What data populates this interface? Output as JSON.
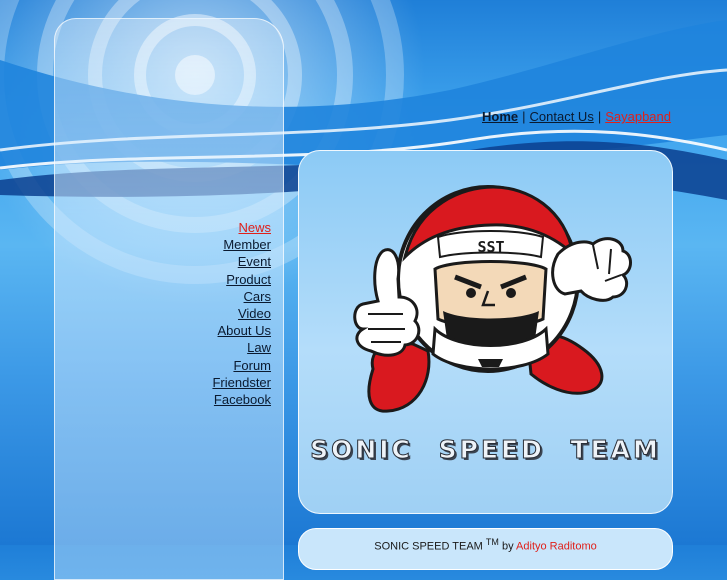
{
  "top_nav": {
    "home": "Home",
    "separator": "|",
    "contact": "Contact Us",
    "sayapband": "Sayapband"
  },
  "sidebar": {
    "items": [
      {
        "label": "News",
        "active": true
      },
      {
        "label": "Member"
      },
      {
        "label": "Event"
      },
      {
        "label": "Product"
      },
      {
        "label": "Cars"
      },
      {
        "label": "Video"
      },
      {
        "label": "About Us"
      },
      {
        "label": "Law"
      },
      {
        "label": "Forum"
      },
      {
        "label": "Friendster"
      },
      {
        "label": "Facebook"
      }
    ],
    "extra_link": " "
  },
  "mascot": {
    "helmet_text": "SST",
    "icon": "racing-mascot-thumbs-up"
  },
  "brand": {
    "title": "SONIC SPEED TEAM"
  },
  "footer": {
    "text": "SONIC SPEED TEAM",
    "trademark": "TM",
    "by": "by",
    "author": "Adityo Raditomo"
  },
  "colors": {
    "link": "#0a1a30",
    "active_link": "#e0201a",
    "panel": "#b4ddfa",
    "background": "#3fa4ee"
  }
}
